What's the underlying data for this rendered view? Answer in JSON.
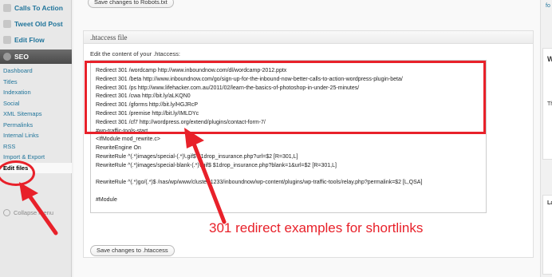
{
  "sidebar": {
    "top_items": [
      {
        "label": "Calls To Action",
        "icon": "calls-to-action-icon"
      },
      {
        "label": "Tweet Old Post",
        "icon": "tweet-icon"
      },
      {
        "label": "Edit Flow",
        "icon": "edit-flow-icon"
      }
    ],
    "seo_label": "SEO",
    "sub_items": [
      "Dashboard",
      "Titles",
      "Indexation",
      "Social",
      "XML Sitemaps",
      "Permalinks",
      "Internal Links",
      "RSS",
      "Import & Export",
      "Edit files"
    ],
    "active_item": "Edit files",
    "collapse_label": "Collapse menu"
  },
  "robots": {
    "save_label": "Save changes to Robots.txt"
  },
  "htaccess": {
    "title": ".htaccess file",
    "label": "Edit the content of your .htaccess:",
    "lines": [
      "Redirect 301 /wordcamp http://www.inboundnow.com/dl/wordcamp-2012.pptx",
      "Redirect 301 /beta http://www.inboundnow.com/go/sign-up-for-the-inbound-now-better-calls-to-action-wordpress-plugin-beta/",
      "Redirect 301 /ps http://www.lifehacker.com.au/2011/02/learn-the-basics-of-photoshop-in-under-25-minutes/",
      "Redirect 301 /cwa http://bit.ly/aLKQN0",
      "Redirect 301 /gforms http://bit.ly/HGJRcP",
      "Redirect 301 /premise http://bit.ly/IMLDYc",
      "Redirect 301 /cf7 http://wordpress.org/extend/plugins/contact-form-7/",
      "#wp-traffic-tools-start",
      "<IfModule mod_rewrite.c>",
      "RewriteEngine On",
      "RewriteRule ^(.*)images/special-(.*)\\.gif$ $1drop_insurance.php?url=$2 [R=301,L]",
      "RewriteRule ^(.*)images/special-blank-(.*)\\.gif$ $1drop_insurance.php?blank=1&url=$2 [R=301,L]",
      "",
      "RewriteRule ^(.*)go/(.*)$ /nas/wp/www/cluster-1233/inboundnow/wp-content/plugins/wp-traffic-tools/relay.php?permalink=$2 [L,QSA]",
      "",
      "#Module"
    ],
    "save_label": "Save changes to .htaccess"
  },
  "right_column": {
    "top_text": "fo",
    "fragments": [
      "W",
      "Th",
      "La"
    ]
  },
  "annotation": {
    "caption": "301 redirect examples for shortlinks",
    "color": "#e8212a"
  }
}
